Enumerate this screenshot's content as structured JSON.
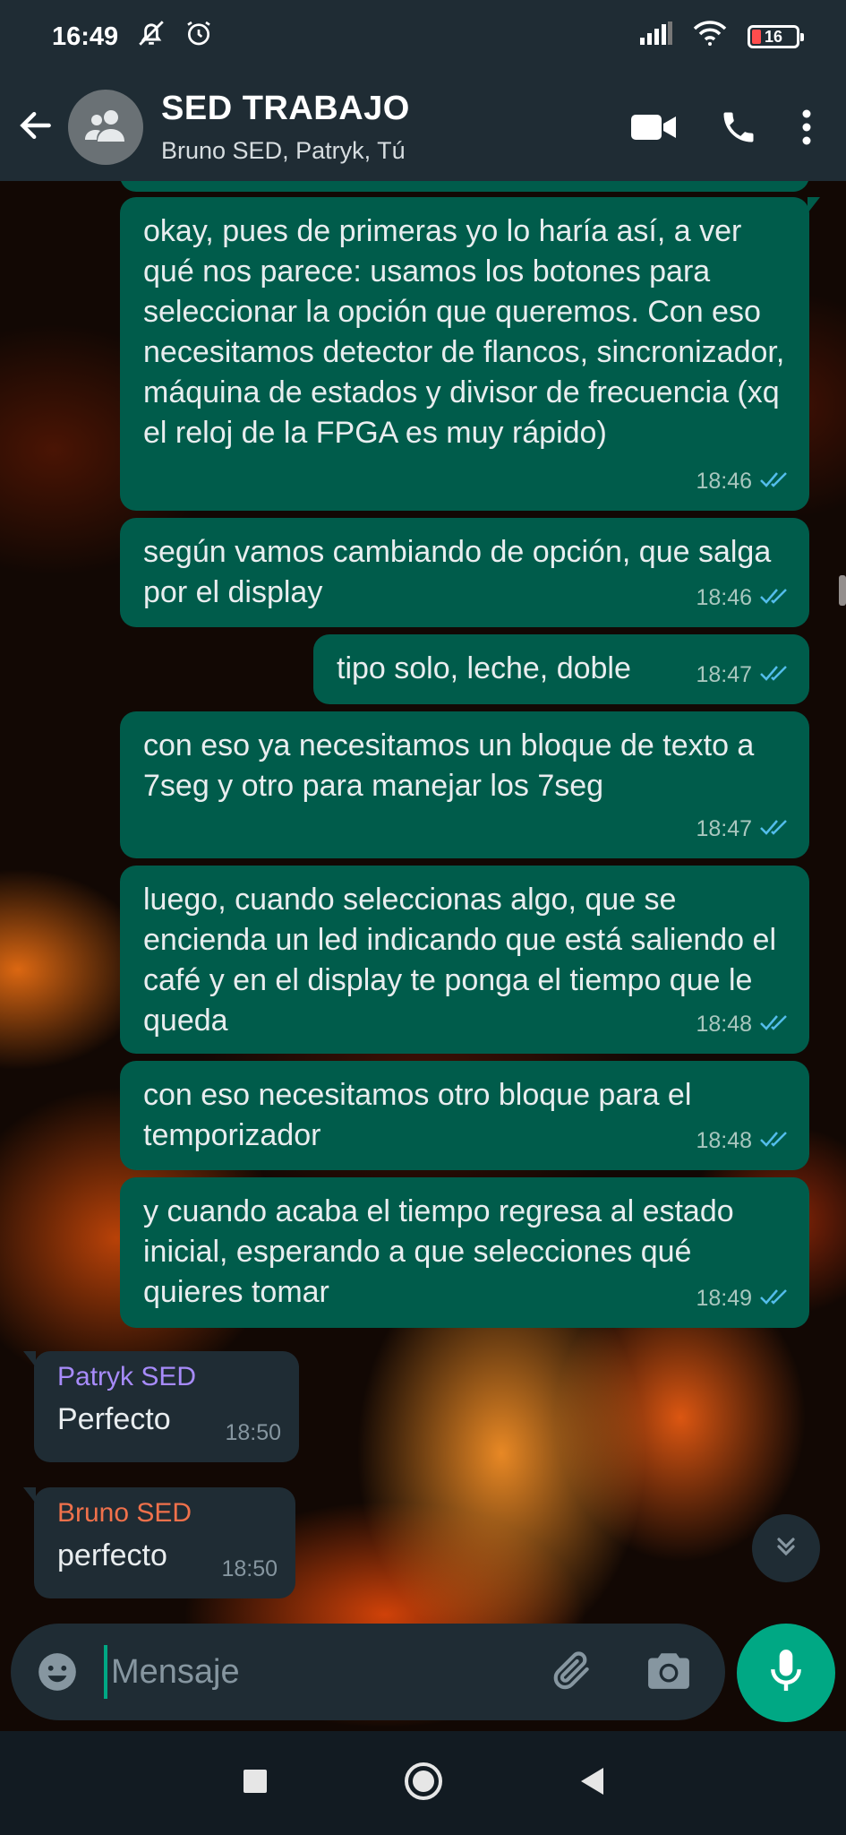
{
  "status_bar": {
    "time": "16:49",
    "battery_level": "16",
    "icons": [
      "mute-alarm-icon",
      "alarm-clock-icon",
      "signal-icon",
      "wifi-icon",
      "battery-icon"
    ]
  },
  "header": {
    "title": "SED TRABAJO",
    "subtitle": "Bruno SED, Patryk, Tú",
    "icons": [
      "back-arrow-icon",
      "group-avatar-icon",
      "video-call-icon",
      "phone-call-icon",
      "more-options-icon"
    ]
  },
  "messages": [
    {
      "direction": "out",
      "text": "okay, pues de primeras yo lo haría así, a ver qué nos parece: usamos los botones para seleccionar la opción que queremos. Con eso necesitamos detector de flancos, sincronizador, máquina de estados y divisor de frecuencia (xq el reloj de la FPGA es muy rápido)",
      "time": "18:46",
      "status": "read"
    },
    {
      "direction": "out",
      "text": "según vamos cambiando de opción, que salga por el display",
      "time": "18:46",
      "status": "read"
    },
    {
      "direction": "out",
      "text": "tipo solo, leche, doble",
      "time": "18:47",
      "status": "read"
    },
    {
      "direction": "out",
      "text": "con eso ya necesitamos un bloque de texto a 7seg y otro para manejar los 7seg",
      "time": "18:47",
      "status": "read"
    },
    {
      "direction": "out",
      "text": "luego, cuando seleccionas algo, que se encienda un led indicando que está saliendo el café y en el display te ponga el tiempo que le queda",
      "time": "18:48",
      "status": "read"
    },
    {
      "direction": "out",
      "text": "con eso necesitamos otro bloque para el temporizador",
      "time": "18:48",
      "status": "read"
    },
    {
      "direction": "out",
      "text": "y cuando acaba el tiempo regresa al estado inicial, esperando a que selecciones qué quieres tomar",
      "time": "18:49",
      "status": "read"
    },
    {
      "direction": "in",
      "sender": "Patryk SED",
      "sender_color": "#a78bfa",
      "text": "Perfecto",
      "time": "18:50"
    },
    {
      "direction": "in",
      "sender": "Bruno SED",
      "sender_color": "#f0714b",
      "text": "perfecto",
      "time": "18:50"
    }
  ],
  "composer": {
    "placeholder": "Mensaje",
    "value": ""
  },
  "colors": {
    "header_bg": "#1f2c34",
    "outgoing_bubble": "#005c4b",
    "incoming_bubble": "#1f2c34",
    "accent": "#00a884",
    "read_ticks": "#53bdeb"
  }
}
